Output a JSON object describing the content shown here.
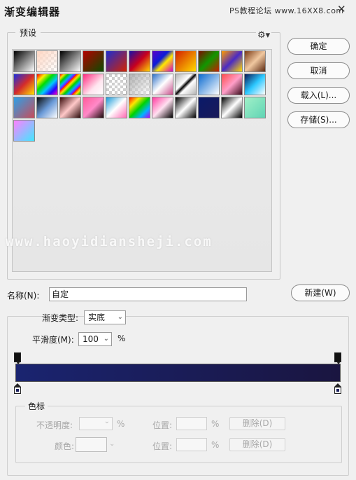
{
  "window": {
    "title": "渐变编辑器",
    "watermark_top": "PS教程论坛 www.16XX8.com",
    "watermark_mid": "www.haoyidiansheji.com"
  },
  "presets": {
    "label": "预设",
    "gear_icon": "gear-icon",
    "swatches": [
      "linear-gradient(135deg,#000 0%,#fff 100%)",
      "linear-gradient(135deg,#ffd7c4 0%,rgba(255,255,255,0.2) 100%),repeating-conic-gradient(#ddd 0% 25%,#fff 0% 50%) 0 0/8px 8px",
      "linear-gradient(135deg,#000 0%,#fff 100%)",
      "linear-gradient(135deg,#b40000 0%,#0a4c00 100%)",
      "linear-gradient(135deg,#1d2ccf 0%,#d42300 100%)",
      "linear-gradient(135deg,#1a10a8 0%,#c8001e 50%,#ffd800 100%)",
      "linear-gradient(135deg,#5a00c8 0%,#0a1cd8 40%,#ffe800 60%,#d400c8 100%)",
      "linear-gradient(135deg,#d42000 0%,#ffdc00 100%)",
      "linear-gradient(135deg,#7d0d00 0%,#119600 50%,#c81c00 100%)",
      "linear-gradient(135deg,#ff9a00 0%,#4a2ac4 50%,#ffdc00 100%)",
      "linear-gradient(135deg,#7a3a14 0%,#f0c8a0 50%,#5a2810 100%)",
      "linear-gradient(135deg,#1a2fe0 0%,#d42b2b 50%,#ffe200 100%)",
      "linear-gradient(135deg,#ff0000 0%,#ffee00 20%,#00dd00 40%,#00c8ff 60%,#2a00ff 80%,#ff00c8 100%)",
      "repeating-linear-gradient(135deg,#ff0000 0px,#ffe200 4px,#00d000 8px,#00aaff 12px,#8a00ff 16px)",
      "linear-gradient(135deg,#ff2b80 0%,#ffe5ef 60%,#ffffff 100%),repeating-conic-gradient(#ddd 0% 25%,#fff 0% 50%) 0 0/8px 8px",
      "repeating-conic-gradient(#cfcfcf 0% 25%,#ffffff 0% 50%) 0 0/8px 8px",
      "linear-gradient(135deg,rgba(160,160,160,0.8) 0%,rgba(255,255,255,0.2) 100%),repeating-conic-gradient(#ddd 0% 25%,#fff 0% 50%) 0 0/8px 8px",
      "linear-gradient(135deg,#2c70c8 0%,#ffffff 50%,#c8508c 100%)",
      "linear-gradient(135deg,#b4b4b4 0%,#fff 40%,#000 50%,#fff 60%,#b4b4b4 100%)",
      "linear-gradient(135deg,#0a6ad0 0%,#ffffff 100%)",
      "linear-gradient(135deg,#ff4c4c 0%,#ff9ec8 50%,#3a0a1a 100%)",
      "linear-gradient(135deg,#0a1a58 0%,#2cc8ff 50%,#ffffff 100%)",
      "linear-gradient(135deg,#2ca0e8 0%,#c84c5a 100%)",
      "linear-gradient(135deg,#0a0a0a 0%,#6a9ad8 50%,#ffffff 100%)",
      "linear-gradient(135deg,#3a0a0a 0%,#ffc8c8 50%,#2a0a0a 100%)",
      "linear-gradient(135deg,#ff5a9a 0%,#ff8ac8 50%,#1a0a0a 100%)",
      "linear-gradient(135deg,#1a9ad8 0%,#ffffff 50%,#ff6ab4 100%)",
      "linear-gradient(135deg,#ff1a00 0%,#ffe600 25%,#00d200 50%,#00b4ff 75%,#b400ff 100%)",
      "linear-gradient(135deg,#ff3aa0 0%,#ffe0f0 50%,#000 100%)",
      "linear-gradient(135deg,#000 0%,#ffffff 50%,#000 100%)",
      "linear-gradient(135deg,#0a1a6a 0%,#1a1a58 100%)",
      "linear-gradient(135deg,#000000 0%,#ffffff 50%,#000 100%)",
      "linear-gradient(135deg,#a0f0c8 0%,#60d4b4 100%)",
      "linear-gradient(135deg,#ff80ff 0%,#40e8ff 100%)"
    ]
  },
  "buttons": {
    "ok": "确定",
    "cancel": "取消",
    "load": "载入(L)...",
    "save": "存储(S)...",
    "new": "新建(W)"
  },
  "name": {
    "label": "名称(N):",
    "value": "自定"
  },
  "gradient": {
    "type_label": "渐变类型:",
    "type_value": "实底",
    "smooth_label": "平滑度(M):",
    "smooth_value": "100",
    "smooth_unit": "%",
    "bar_colors": [
      "#1a2470",
      "#1a1540"
    ]
  },
  "color_stops": {
    "group_label": "色标",
    "opacity_label": "不透明度:",
    "opacity_unit": "%",
    "color_label": "颜色:",
    "location_label_1": "位置:",
    "location_unit_1": "%",
    "delete_label_1": "删除(D)",
    "location_label_2": "位置:",
    "location_unit_2": "%",
    "delete_label_2": "删除(D)"
  }
}
